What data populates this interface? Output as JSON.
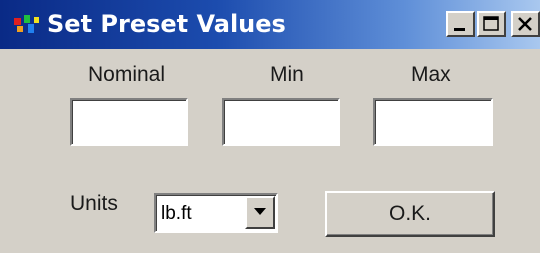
{
  "window": {
    "title": "Set Preset Values",
    "title_bar_color": "#0a2a86",
    "controls": [
      "minimize-icon",
      "maximize-icon",
      "close-icon"
    ]
  },
  "fields": {
    "nominal": {
      "label": "Nominal",
      "value": ""
    },
    "min": {
      "label": "Min",
      "value": ""
    },
    "max": {
      "label": "Max",
      "value": ""
    }
  },
  "units": {
    "label": "Units",
    "selected": "lb.ft"
  },
  "ok_button": {
    "label": "O.K."
  }
}
